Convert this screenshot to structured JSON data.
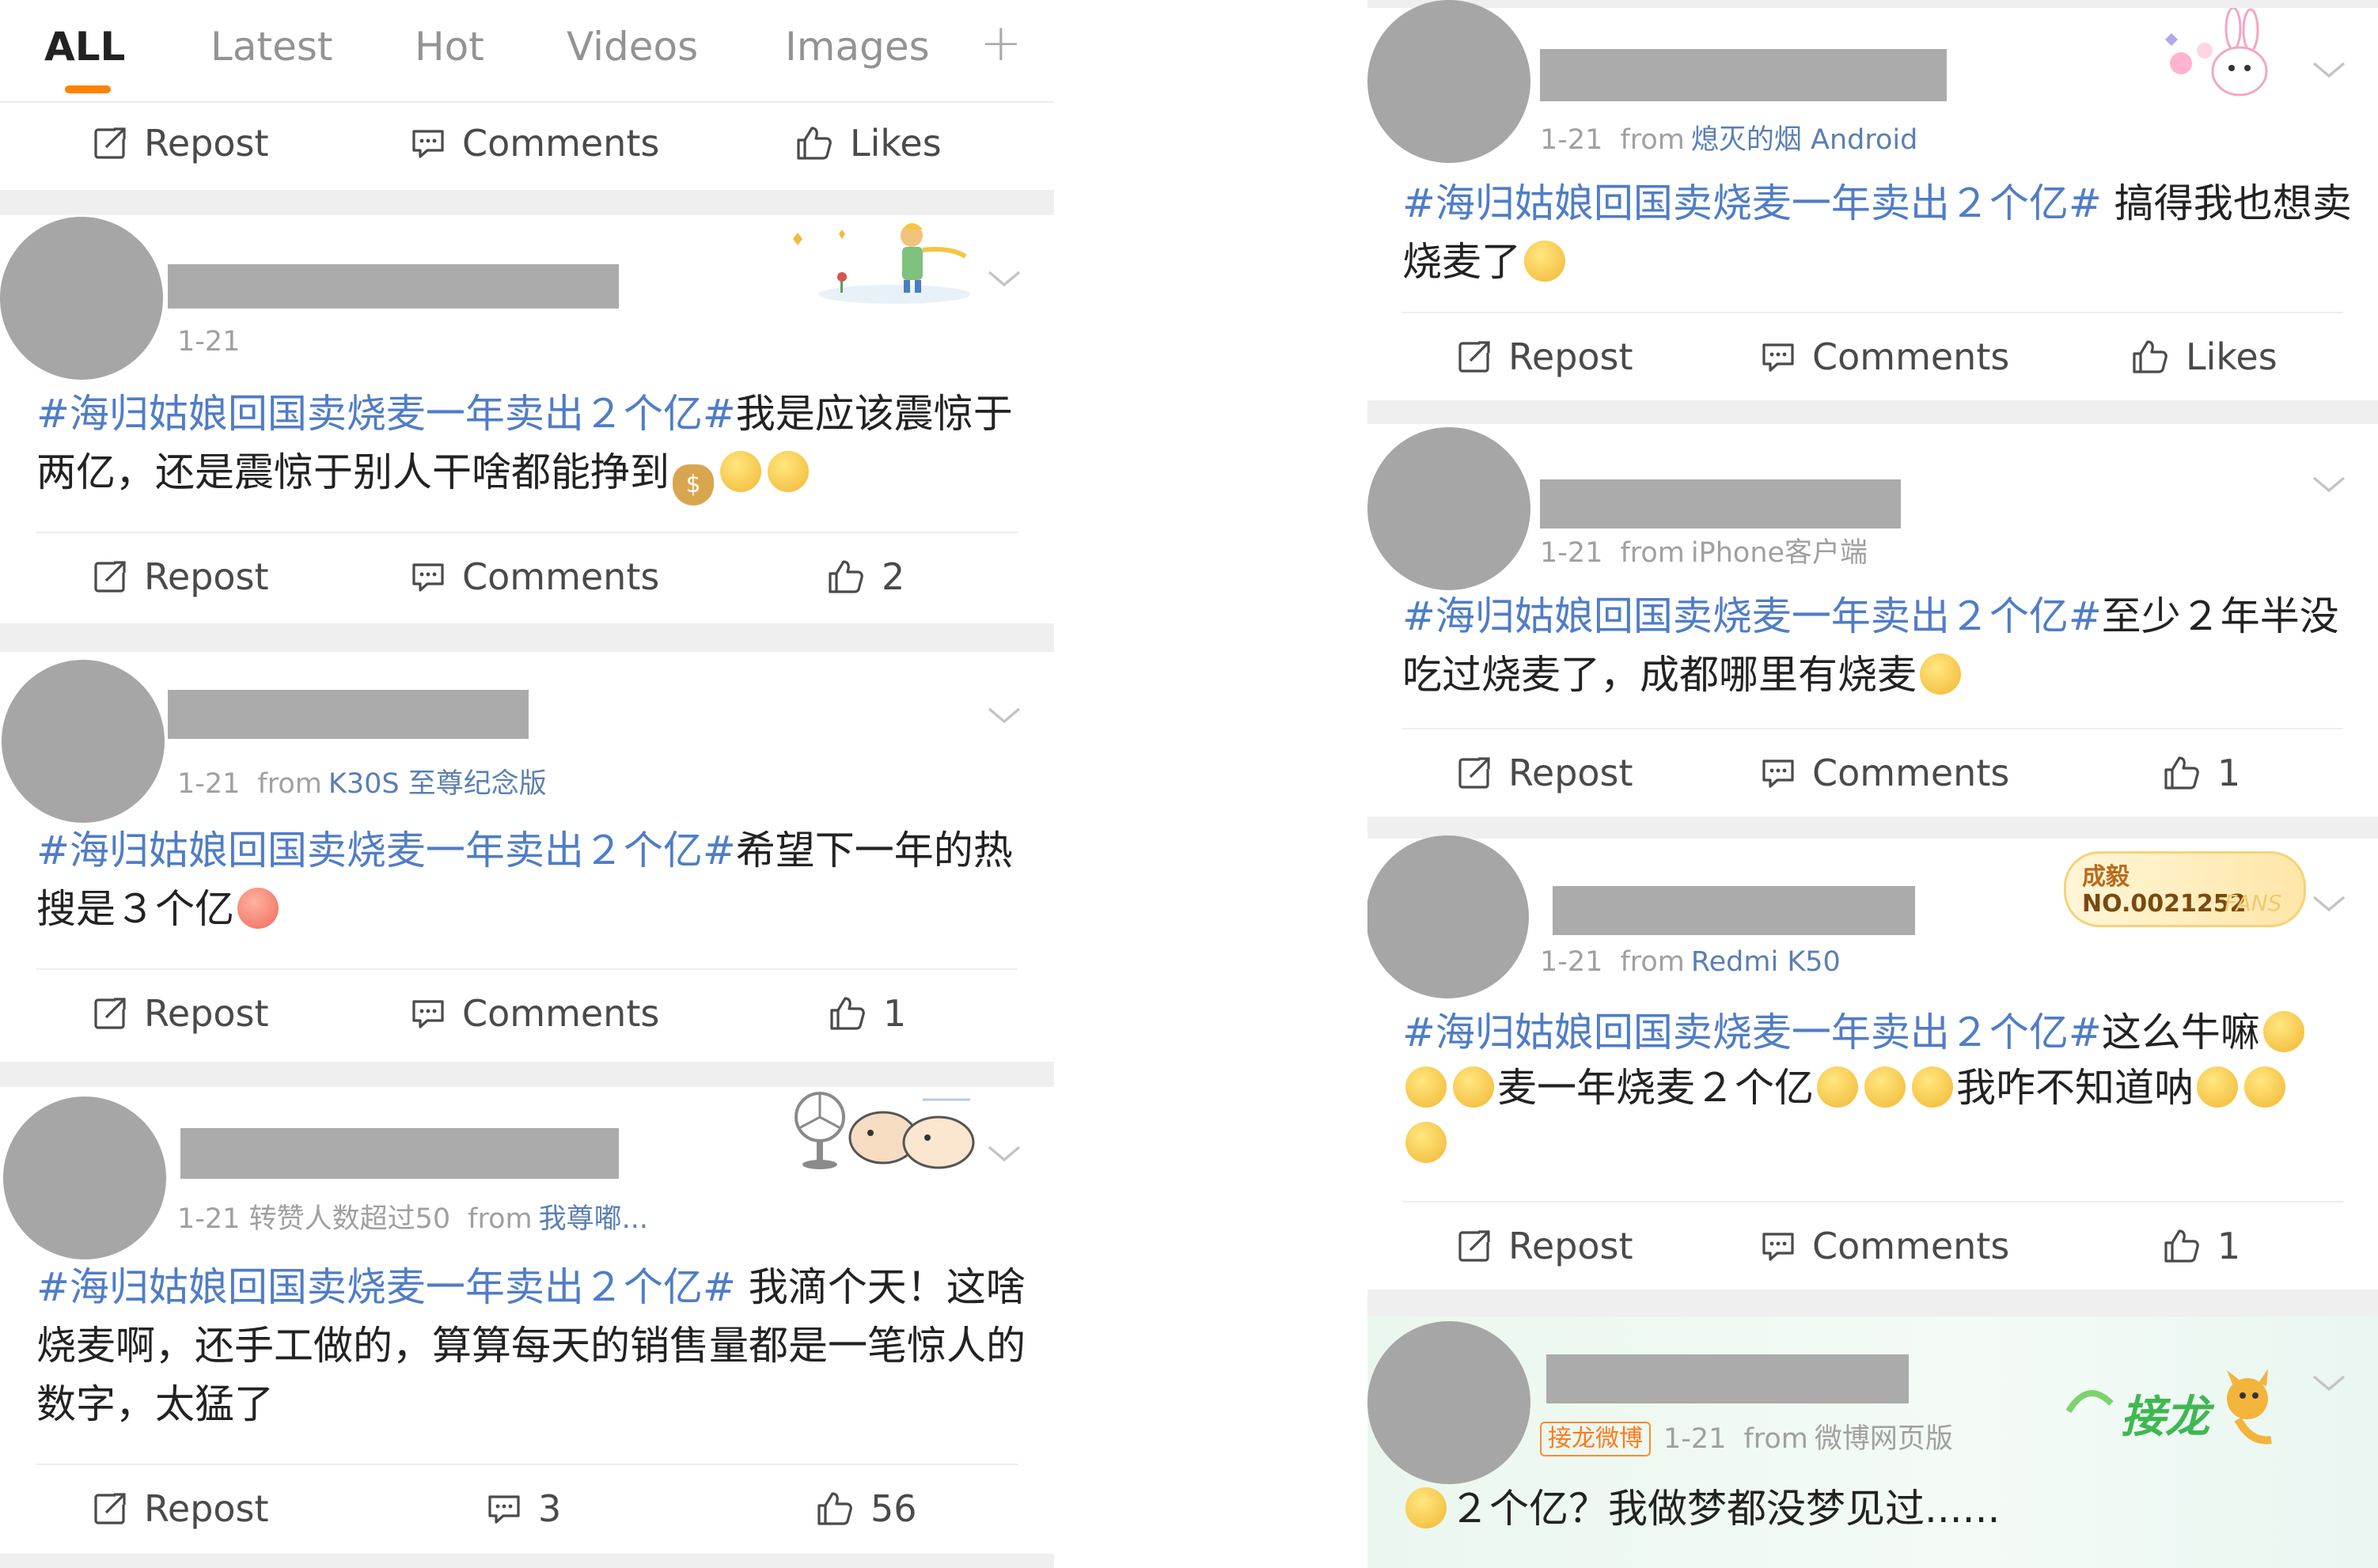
{
  "tabs": [
    "ALL",
    "Latest",
    "Hot",
    "Videos",
    "Images"
  ],
  "tab_plus": "+",
  "actions": {
    "repost": "Repost",
    "comments": "Comments",
    "likes": "Likes"
  },
  "topic": "#海归姑娘回国卖烧麦一年卖出２个亿#",
  "from_label": "from",
  "colors": {
    "accent": "#ff8200",
    "topic_link": "#4f7dc7",
    "source_link": "#5a7fb3",
    "separator": "#efefef"
  },
  "left_posts": [
    {
      "date": "1-21",
      "source": "",
      "body": "我是应该震惊于两亿，还是震惊于别人干啥都能挣到",
      "comments": "Comments",
      "likes": "2"
    },
    {
      "date": "1-21",
      "source": "K30S 至尊纪念版",
      "body": "希望下一年的热搜是３个亿",
      "comments": "Comments",
      "likes": "1"
    },
    {
      "date": "1-21",
      "extra": "转赞人数超过50",
      "source": "我尊嘟...",
      "body": " 我滴个天！这啥烧麦啊，还手工做的，算算每天的销售量都是一笔惊人的数字，太猛了",
      "comments": "3",
      "likes": "56"
    }
  ],
  "right_posts": [
    {
      "date": "1-21",
      "source": "熄灭的烟 Android",
      "body": " 搞得我也想卖烧麦了",
      "comments": "Comments",
      "likes": "Likes"
    },
    {
      "date": "1-21",
      "source": "iPhone客户端",
      "body": "至少２年半没吃过烧麦了，成都哪里有烧麦",
      "comments": "Comments",
      "likes": "1"
    },
    {
      "date": "1-21",
      "source": "Redmi K50",
      "body_a": "这么牛嘛",
      "body_b": "麦一年烧麦２个亿",
      "body_c": "我咋不知道呐",
      "comments": "Comments",
      "likes": "1",
      "fan_badge": {
        "title": "成毅",
        "number": "NO.0021252",
        "tag": "FANS"
      }
    },
    {
      "tag": "接龙微博",
      "date": "1-21",
      "source": "微博网页版",
      "body": "２个亿？我做梦都没梦见过......",
      "badge": "接龙"
    }
  ]
}
